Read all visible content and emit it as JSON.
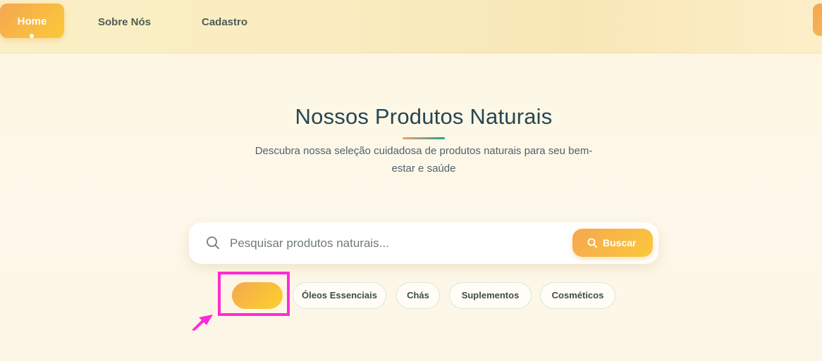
{
  "header": {
    "nav": [
      {
        "label": "Home",
        "active": true
      },
      {
        "label": "Sobre Nós",
        "active": false
      },
      {
        "label": "Cadastro",
        "active": false
      }
    ]
  },
  "hero": {
    "title": "Nossos Produtos Naturais",
    "subtitle": "Descubra nossa seleção cuidadosa de produtos naturais para seu bem-estar e saúde"
  },
  "search": {
    "placeholder": "Pesquisar produtos naturais...",
    "value": "",
    "button_label": "Buscar",
    "icon": "search-icon"
  },
  "filters": {
    "active_chip_label": "",
    "chips": [
      {
        "label": "Óleos Essenciais"
      },
      {
        "label": "Chás"
      },
      {
        "label": "Suplementos"
      },
      {
        "label": "Cosméticos"
      }
    ]
  },
  "colors": {
    "accent_gradient_start": "#f5a751",
    "accent_gradient_end": "#fbc93a",
    "title_color": "#264653",
    "annotation_color": "#ff2bd6"
  }
}
